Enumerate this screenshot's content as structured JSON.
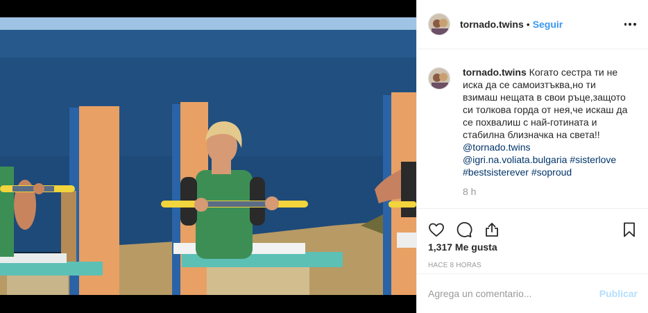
{
  "post": {
    "username": "tornado.twins",
    "follow_label": "Seguir",
    "separator": "•",
    "more_icon": "more-options-icon"
  },
  "caption": {
    "username": "tornado.twins",
    "text": "Когато сестра ти не иска да се самоизтъква,но ти взимаш нещата в свои ръце,защото си толкова горда от нея,че искаш да се похвалиш с най-готината и стабилна близначка на света!!",
    "mentions": [
      "@tornado.twins",
      "@igri.na.voliata.bulgaria"
    ],
    "hashtags": [
      "#sisterlove",
      "#bestsisterever",
      "#soproud"
    ],
    "time": "8 h"
  },
  "actions": {
    "like_icon": "heart-icon",
    "comment_icon": "comment-icon",
    "share_icon": "share-icon",
    "save_icon": "bookmark-icon",
    "likes_text": "1,317 Me gusta",
    "timestamp": "HACE 8 HORAS"
  },
  "comment_box": {
    "placeholder": "Agrega un comentario...",
    "publish_label": "Publicar"
  },
  "colors": {
    "link": "#003569",
    "follow": "#3897f0",
    "publish_disabled": "#b2dffc",
    "muted": "#999999"
  }
}
